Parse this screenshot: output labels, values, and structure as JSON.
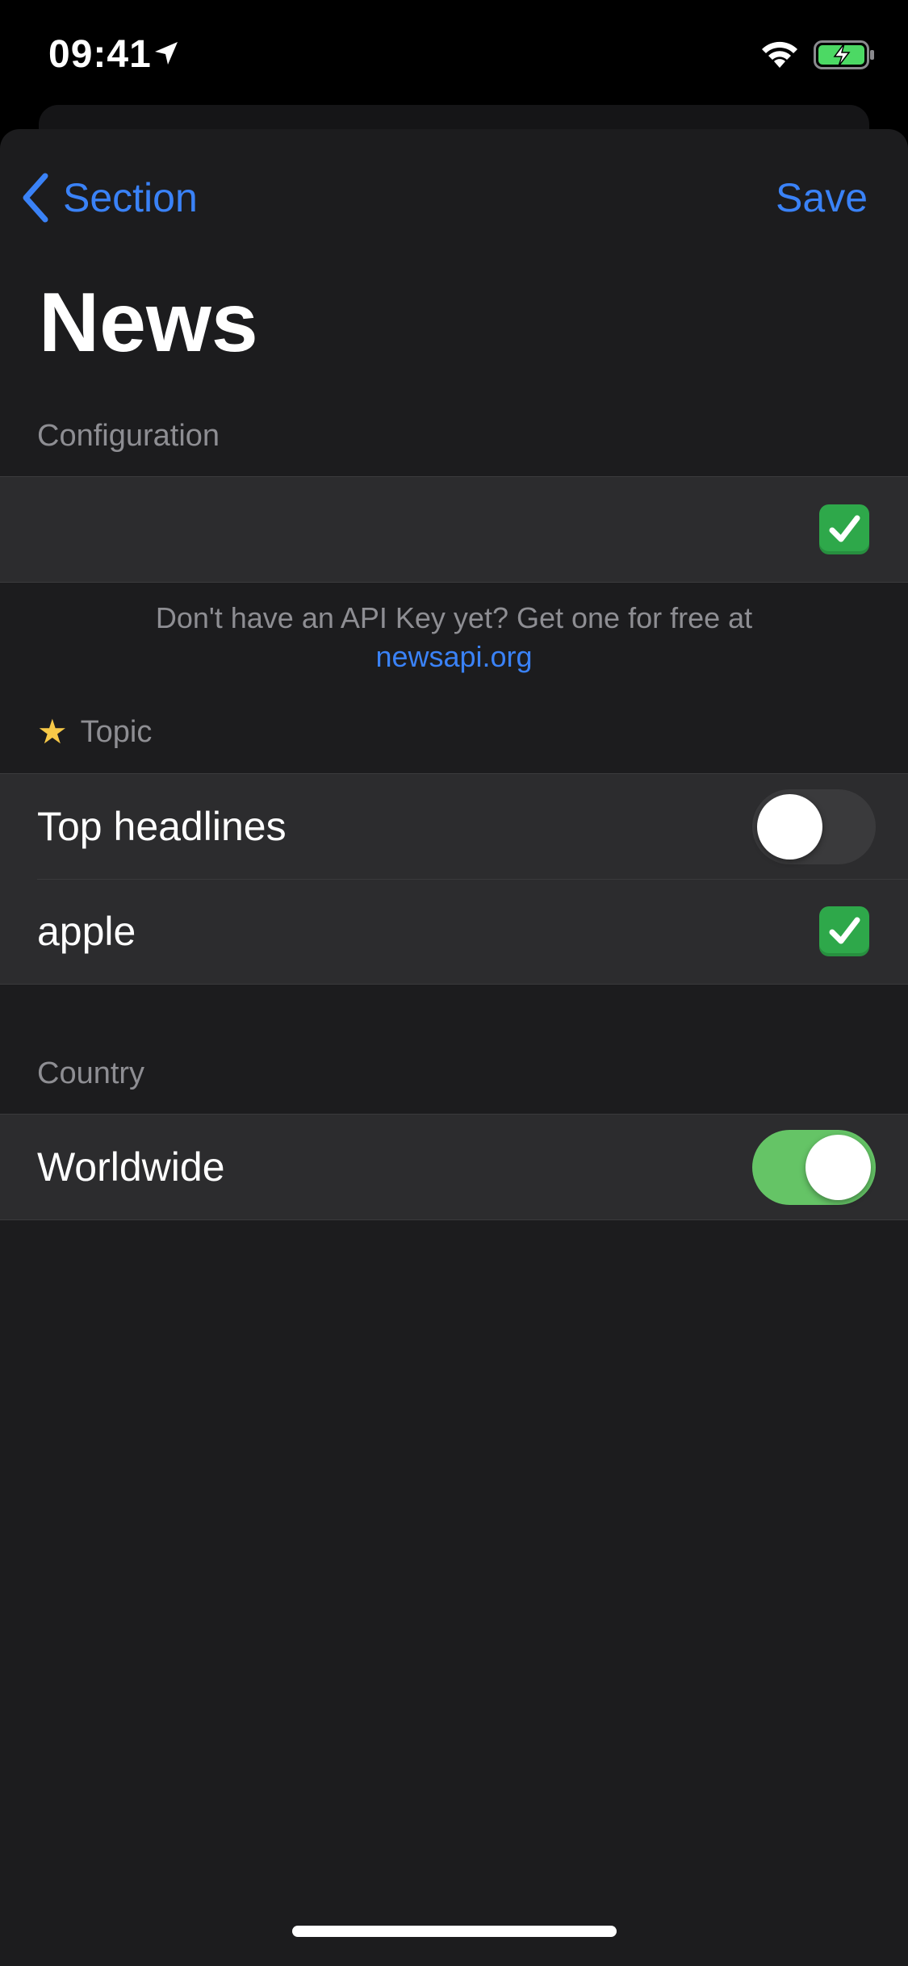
{
  "status_bar": {
    "time": "09:41",
    "icons": [
      "location-arrow-icon",
      "wifi-icon",
      "battery-charging-icon"
    ]
  },
  "nav": {
    "back_label": "Section",
    "save_label": "Save",
    "title": "News"
  },
  "configuration": {
    "header": "Configuration",
    "api_key_value": "",
    "api_key_valid_icon": "check-mark-button-icon",
    "footer_text": "Don't have an API Key yet? Get one for free at",
    "footer_link": "newsapi.org"
  },
  "topic": {
    "header_icon": "star-icon",
    "header": "Topic",
    "rows": [
      {
        "label": "Top headlines",
        "toggle": false
      },
      {
        "label": "apple",
        "icon": "check-mark-button-icon"
      }
    ]
  },
  "country": {
    "header": "Country",
    "rows": [
      {
        "label": "Worldwide",
        "toggle": true
      }
    ]
  },
  "colors": {
    "accent": "#3a82f7",
    "background": "#1c1c1e",
    "cell": "#2c2c2e",
    "toggle_on": "#65c466",
    "check_green": "#2ea84a"
  }
}
